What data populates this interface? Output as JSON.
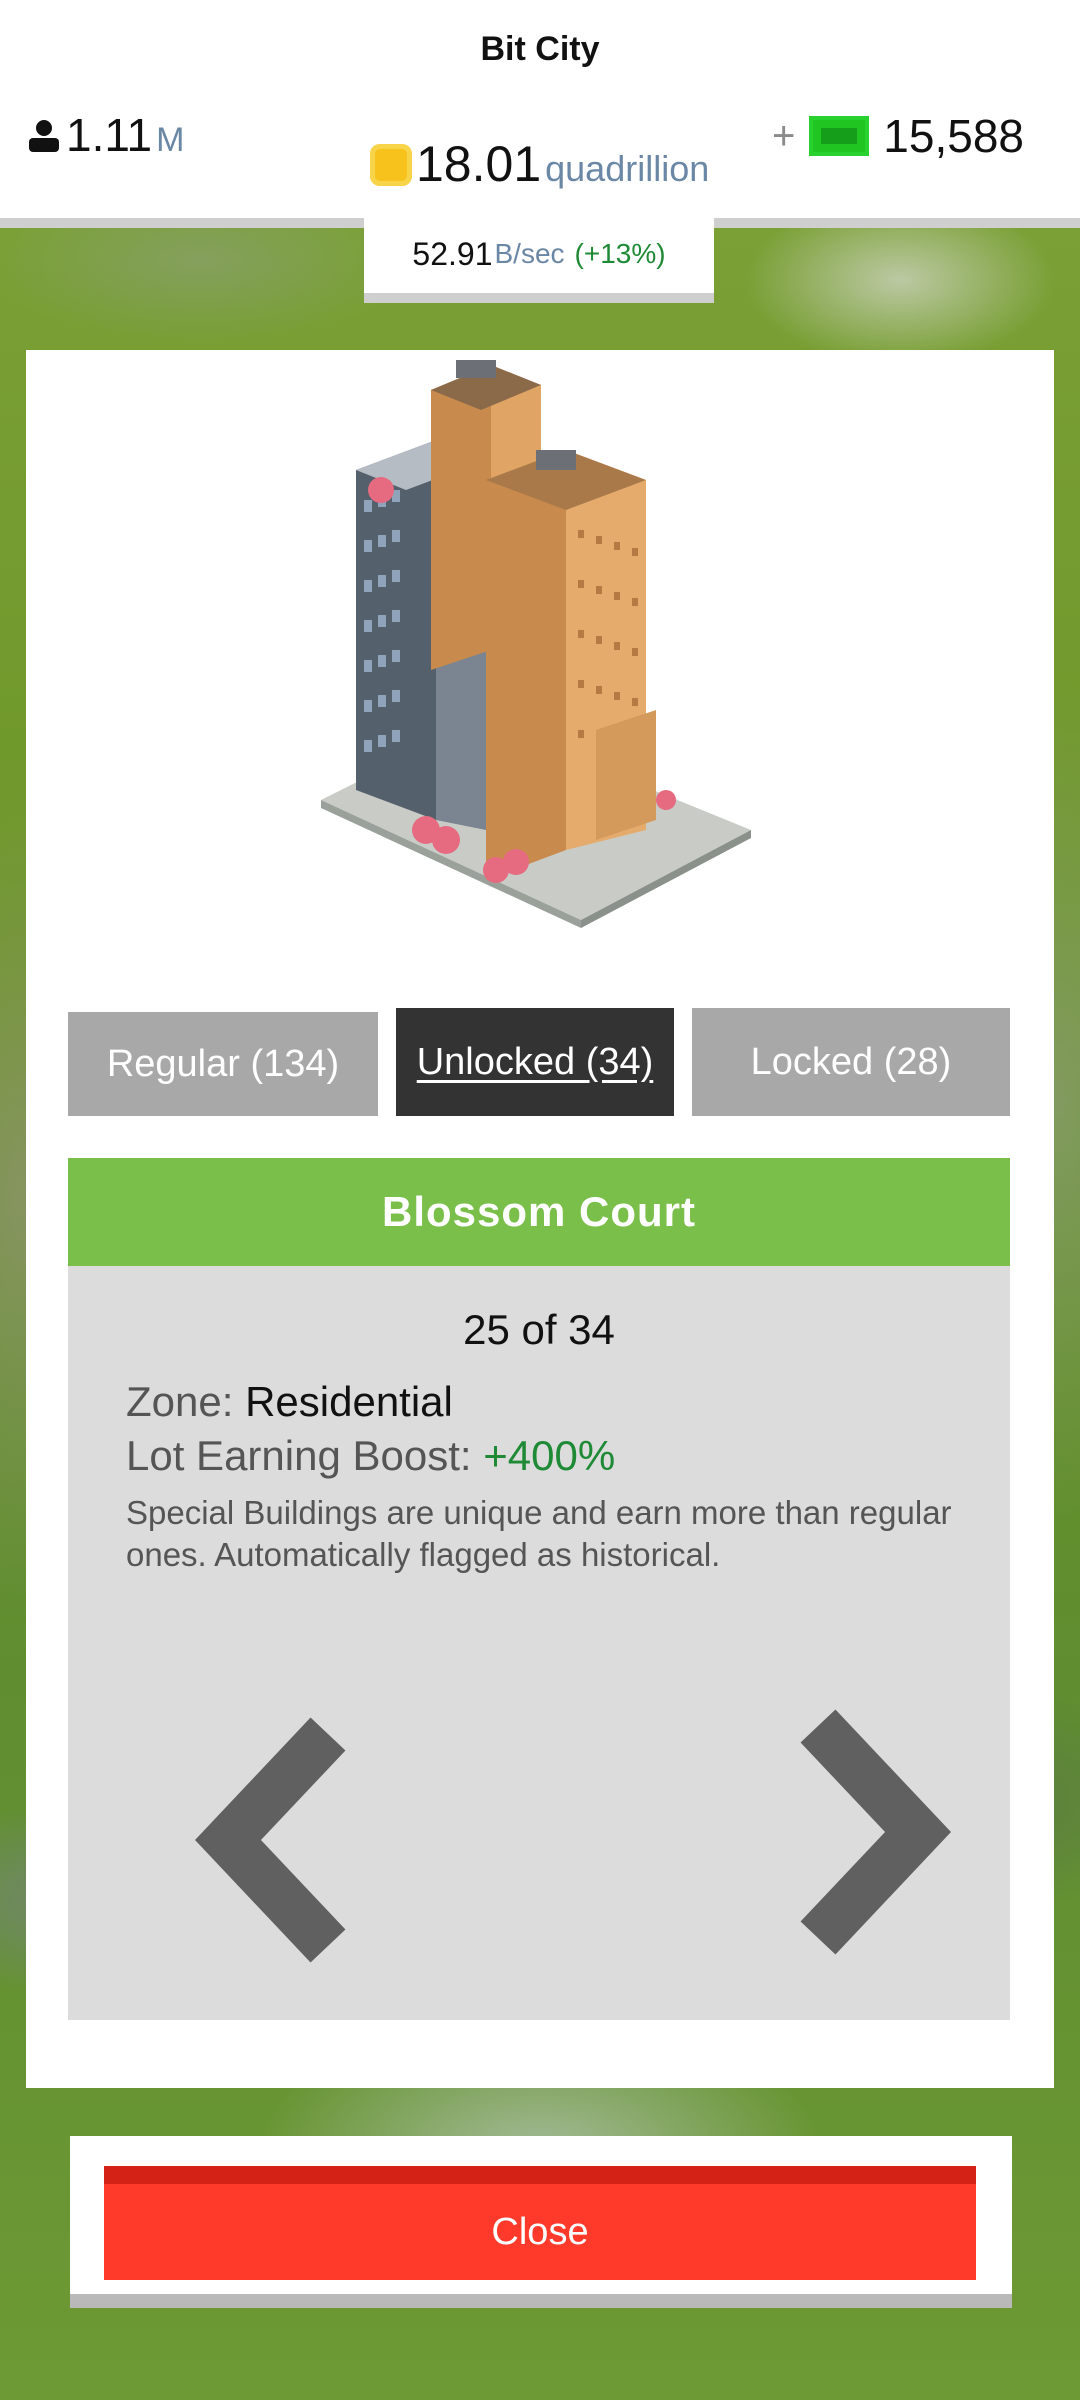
{
  "app": {
    "title": "Bit City"
  },
  "stats": {
    "population": {
      "value": "1.11",
      "unit": "M"
    },
    "gold": {
      "value": "18.01",
      "unit": "quadrillion"
    },
    "cash": {
      "plus": "+",
      "value": "15,588"
    },
    "rate": {
      "value": "52.91",
      "unit": "B/sec",
      "percent": "(+13%)"
    }
  },
  "tabs": [
    {
      "label": "Regular (134)"
    },
    {
      "label": "Unlocked (34)"
    },
    {
      "label": "Locked (28)"
    }
  ],
  "building": {
    "name": "Blossom Court",
    "counter": "25 of 34",
    "zone_label": "Zone:",
    "zone_value": "Residential",
    "boost_label": "Lot Earning Boost:",
    "boost_value": "+400%",
    "description": "Special Buildings are unique and earn more than regular ones. Automatically flagged as historical."
  },
  "close_label": "Close",
  "colors": {
    "accent_green": "#7bbf4b",
    "close_red": "#ff3a2a",
    "tab_active": "#333333",
    "tab_inactive": "#a8a8a8",
    "positive": "#1f8a36"
  }
}
